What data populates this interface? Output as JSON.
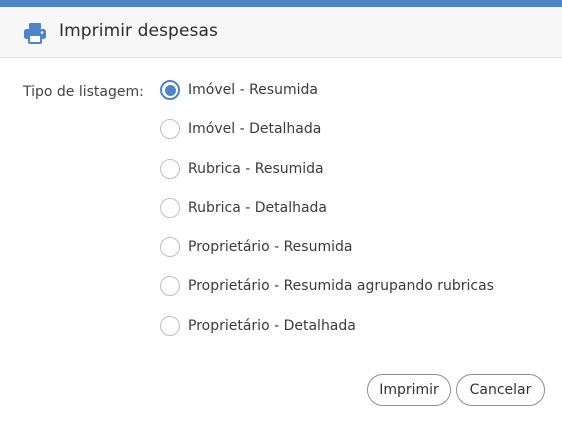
{
  "dialog": {
    "title": "Imprimir despesas",
    "icon": "printer-icon",
    "accent_color": "#4a86c8"
  },
  "form": {
    "label": "Tipo de listagem:",
    "selected_index": 0,
    "options": [
      {
        "label": "Imóvel - Resumida",
        "checked": true
      },
      {
        "label": "Imóvel - Detalhada",
        "checked": false
      },
      {
        "label": "Rubrica - Resumida",
        "checked": false
      },
      {
        "label": "Rubrica - Detalhada",
        "checked": false
      },
      {
        "label": "Proprietário - Resumida",
        "checked": false
      },
      {
        "label": "Proprietário - Resumida agrupando rubricas",
        "checked": false
      },
      {
        "label": "Proprietário - Detalhada",
        "checked": false
      }
    ]
  },
  "buttons": {
    "print_label": "Imprimir",
    "cancel_label": "Cancelar"
  }
}
